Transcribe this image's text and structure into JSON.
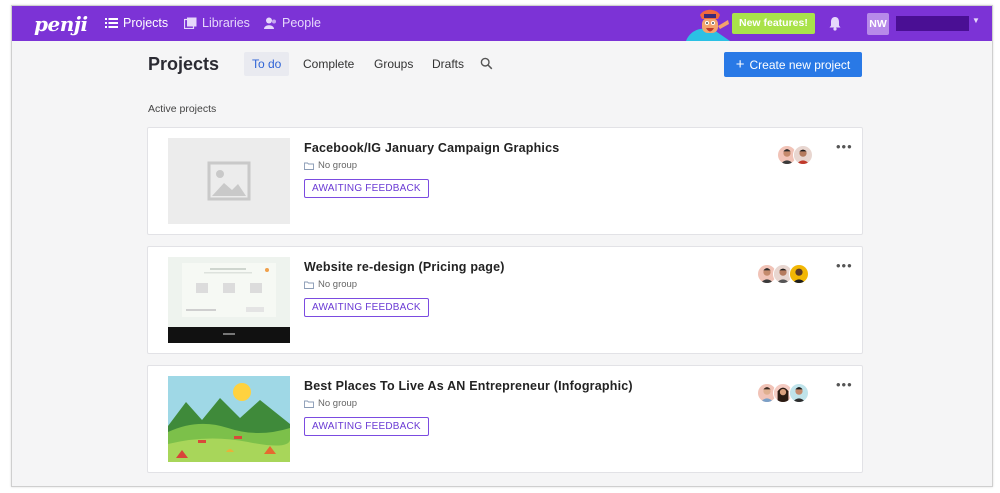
{
  "nav": {
    "logo": "penji",
    "projects": "Projects",
    "libraries": "Libraries",
    "people": "People",
    "new_features": "New features!",
    "user_initials": "NW"
  },
  "header": {
    "title": "Projects",
    "tabs": [
      "To do",
      "Complete",
      "Groups",
      "Drafts"
    ],
    "active_tab": "To do",
    "create_button": "Create new project"
  },
  "section_label": "Active projects",
  "projects": [
    {
      "title": "Facebook/IG January Campaign Graphics",
      "group": "No group",
      "status": "AWAITING FEEDBACK",
      "thumbnail": "image-placeholder-icon",
      "avatar_count": 2
    },
    {
      "title": "Website re-design (Pricing page)",
      "group": "No group",
      "status": "AWAITING FEEDBACK",
      "thumbnail": "website-mockup",
      "avatar_count": 3
    },
    {
      "title": "Best Places To Live As AN Entrepreneur (Infographic)",
      "group": "No group",
      "status": "AWAITING FEEDBACK",
      "thumbnail": "landscape-illustration",
      "avatar_count": 3
    }
  ],
  "colors": {
    "brand_purple": "#7c33d6",
    "accent_blue": "#2979e6",
    "new_features_green": "#a9e24a",
    "badge_purple": "#6a3ad4"
  }
}
